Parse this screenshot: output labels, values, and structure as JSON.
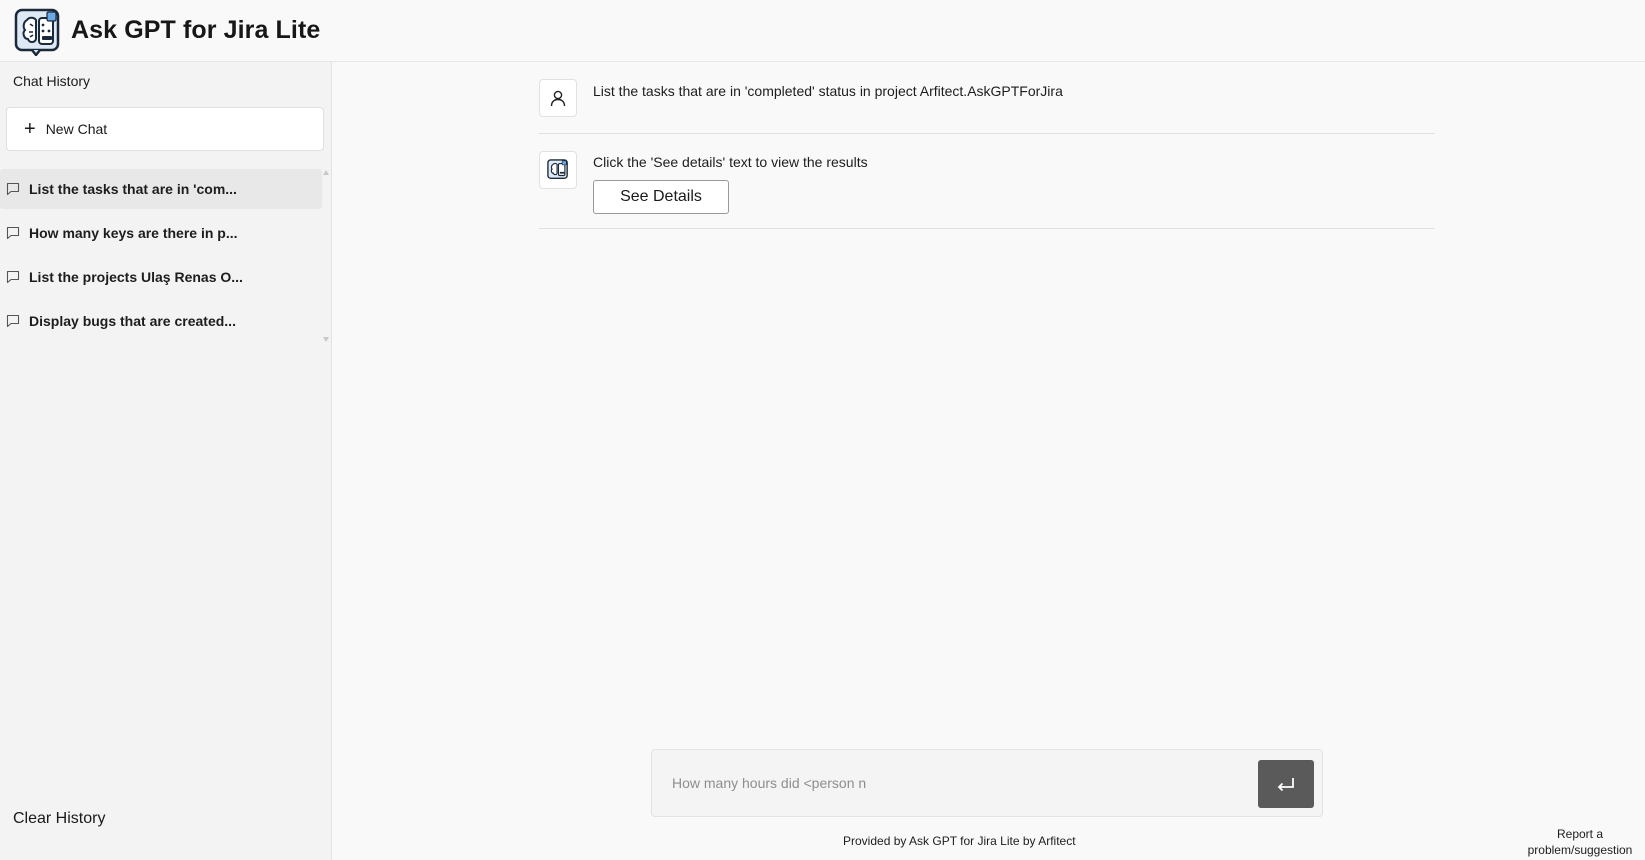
{
  "app": {
    "title": "Ask GPT for Jira Lite",
    "logo_icon": "robot-brain-logo-icon"
  },
  "sidebar": {
    "heading": "Chat History",
    "new_chat_label": "New Chat",
    "items": [
      {
        "label": "List the tasks that are in 'com...",
        "active": true
      },
      {
        "label": "How many keys are there in p...",
        "active": false
      },
      {
        "label": "List the projects Ulaş Renas O...",
        "active": false
      },
      {
        "label": "Display bugs that are created...",
        "active": false
      }
    ],
    "clear_label": "Clear History"
  },
  "conversation": {
    "user_message": "List the tasks that are in 'completed' status in project Arfitect.AskGPTForJira",
    "bot_message": "Click the 'See details' text to view the results",
    "details_button": "See Details"
  },
  "composer": {
    "placeholder": "How many hours did <person n",
    "value": "",
    "send_icon": "enter-return-icon"
  },
  "footer": {
    "credit": "Provided by Ask GPT for Jira Lite by Arfitect",
    "report_label": "Report a problem/suggestion"
  },
  "colors": {
    "background": "#f9f9f9",
    "sidebar": "#f3f3f3",
    "active_item": "#e8e8e8",
    "send_button": "#5a5a5a"
  }
}
